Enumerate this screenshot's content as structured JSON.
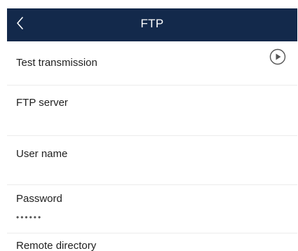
{
  "header": {
    "title": "FTP",
    "back_icon": "chevron-left-icon",
    "background": "#13294b"
  },
  "settings": {
    "test_transmission": {
      "label": "Test transmission",
      "action_icon": "play-circle-icon"
    },
    "ftp_server": {
      "label": "FTP server",
      "value": ""
    },
    "user_name": {
      "label": "User name",
      "value": ""
    },
    "password": {
      "label": "Password",
      "value": "••••••"
    },
    "remote_directory": {
      "label": "Remote directory"
    }
  }
}
